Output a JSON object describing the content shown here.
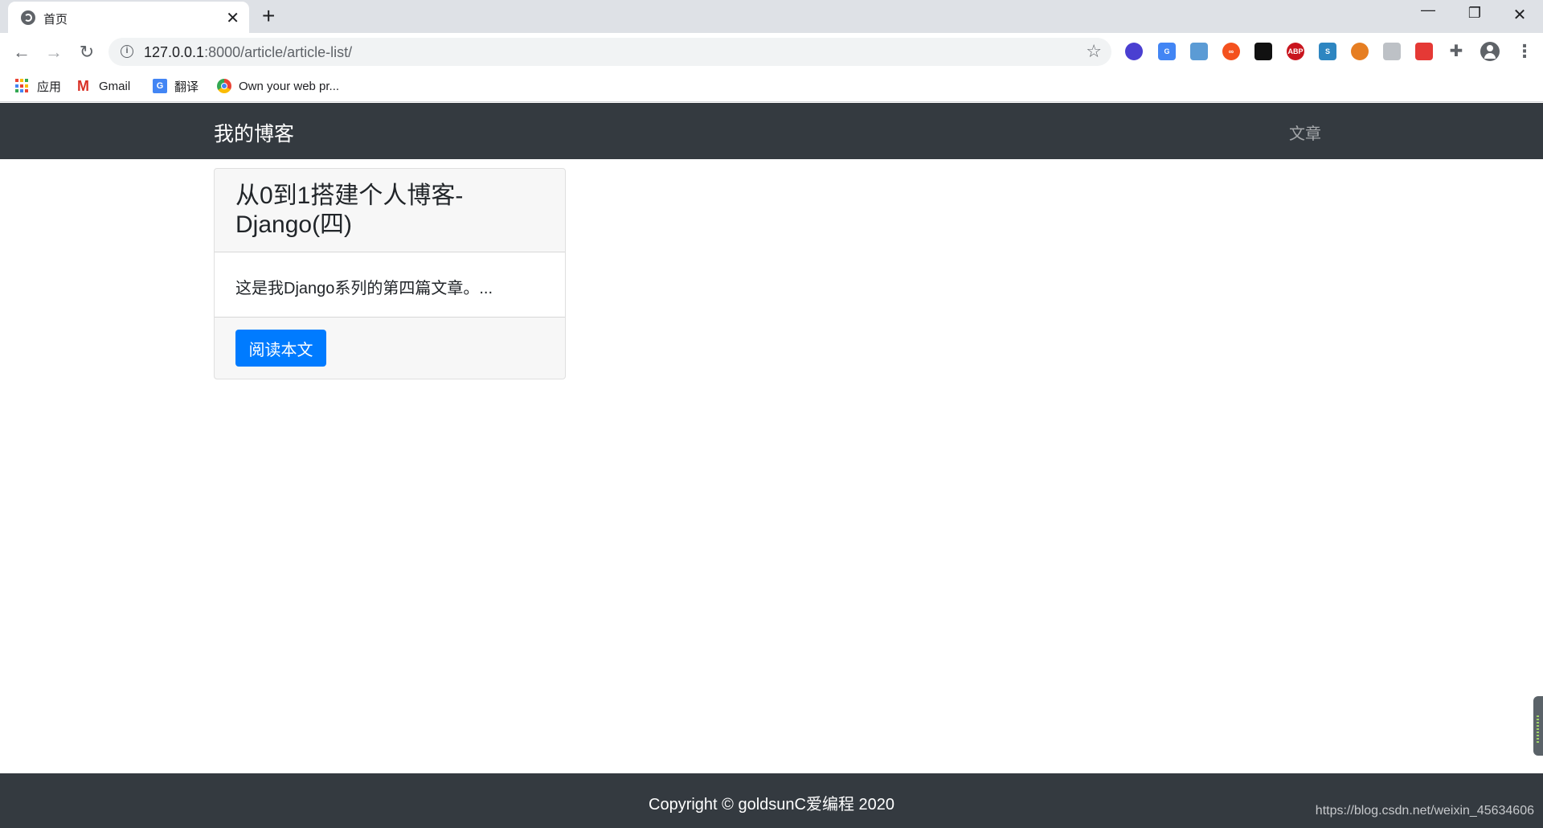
{
  "browser": {
    "tab": {
      "title": "首页"
    },
    "address": {
      "host": "127.0.0.1",
      "path": ":8000/article/article-list/"
    },
    "bookmarks": [
      {
        "label": "应用"
      },
      {
        "label": "Gmail"
      },
      {
        "label": "翻译"
      },
      {
        "label": "Own your web pr..."
      }
    ],
    "extension_badges": {
      "abp": "ABP"
    }
  },
  "site": {
    "brand": "我的博客",
    "nav_link": "文章"
  },
  "articles": [
    {
      "title": "从0到1搭建个人博客-Django(四)",
      "excerpt": "这是我Django系列的第四篇文章。...",
      "button": "阅读本文"
    }
  ],
  "footer": {
    "copyright": "Copyright © goldsunC爱编程 2020",
    "watermark": "https://blog.csdn.net/weixin_45634606"
  }
}
